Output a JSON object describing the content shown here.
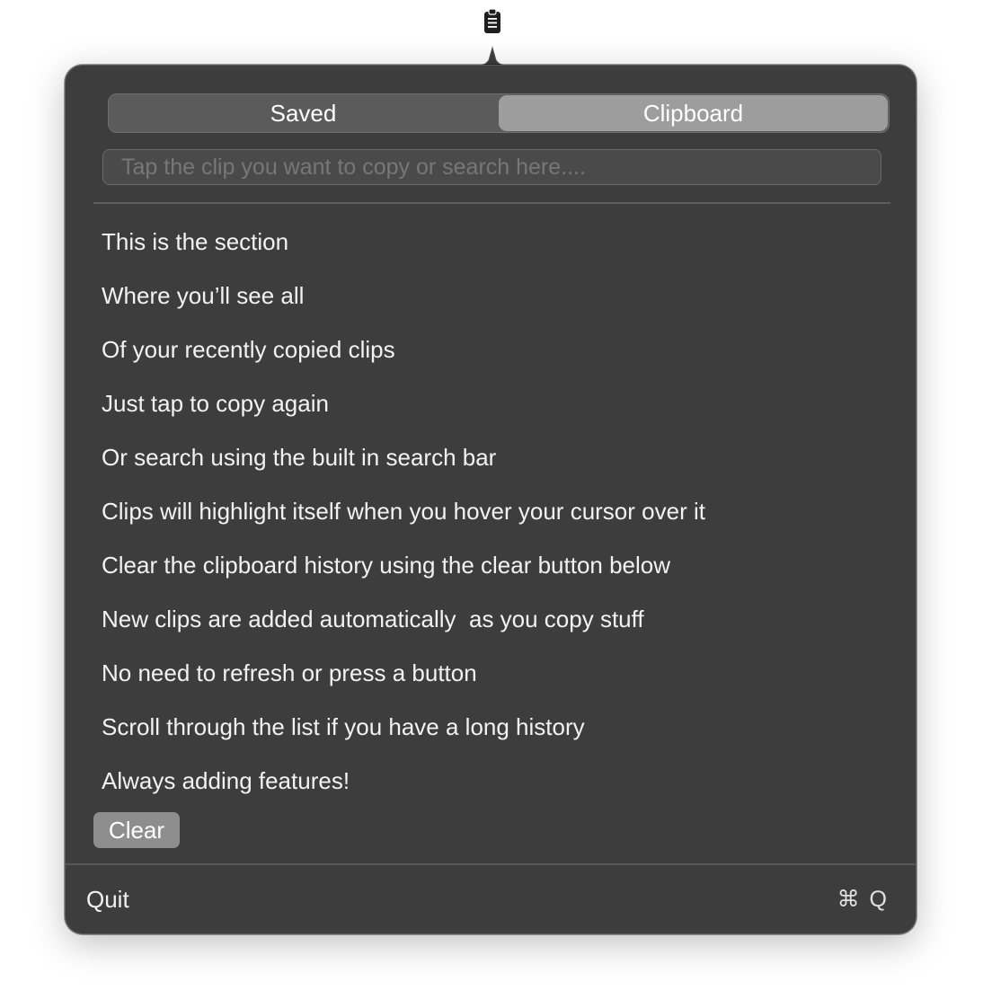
{
  "menubar": {
    "icon": "clipboard-icon"
  },
  "tabs": [
    {
      "label": "Saved",
      "selected": false
    },
    {
      "label": "Clipboard",
      "selected": true
    }
  ],
  "search": {
    "placeholder": "Tap the clip you want to copy or search here....",
    "value": ""
  },
  "clips": [
    "This is the section",
    "Where you’ll see all",
    "Of your recently copied clips",
    "Just tap to copy again",
    "Or search using the built in search bar",
    "Clips will highlight itself when you hover your cursor over it",
    "Clear the clipboard history using the clear button below",
    "New clips are added automatically  as you copy stuff",
    "No need to refresh or press a button",
    "Scroll through the list if you have a long history",
    "Always adding features!"
  ],
  "clear_label": "Clear",
  "quit": {
    "label": "Quit",
    "shortcut": "⌘ Q"
  },
  "colors": {
    "panel": "#3d3d3d",
    "segment_selected": "#9d9d9d",
    "segment_bg": "#5b5b5b",
    "clear_button": "#8e8e8e"
  }
}
